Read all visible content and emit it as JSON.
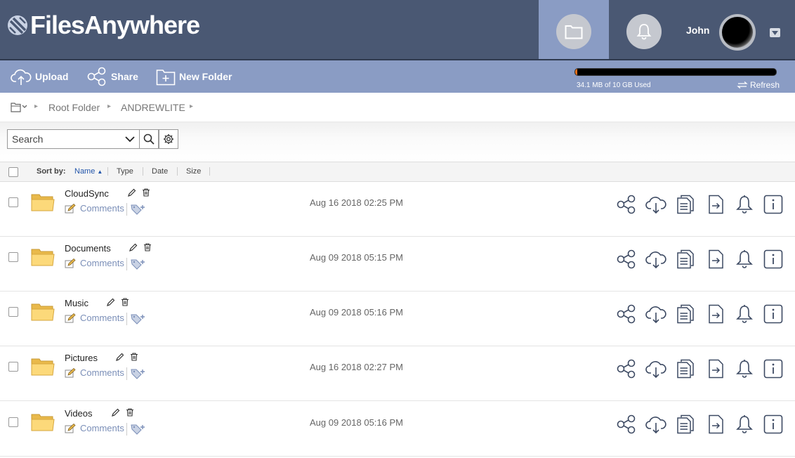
{
  "header": {
    "logo_text": "FilesAnywhere",
    "user_name": "John"
  },
  "toolbar": {
    "upload_label": "Upload",
    "share_label": "Share",
    "new_folder_label": "New Folder",
    "storage_text": "34.1 MB of 10 GB Used",
    "storage_used_fraction": 0.0034,
    "refresh_label": "Refresh"
  },
  "breadcrumb": {
    "items": [
      "Root Folder",
      "ANDREWLITE"
    ]
  },
  "search": {
    "placeholder": "Search"
  },
  "sort": {
    "label": "Sort by:",
    "columns": [
      "Name",
      "Type",
      "Date",
      "Size"
    ],
    "active": "Name"
  },
  "files": [
    {
      "name": "CloudSync",
      "date": "Aug 16 2018 02:25 PM",
      "comments_label": "Comments"
    },
    {
      "name": "Documents",
      "date": "Aug 09 2018 05:15 PM",
      "comments_label": "Comments"
    },
    {
      "name": "Music",
      "date": "Aug 09 2018 05:16 PM",
      "comments_label": "Comments"
    },
    {
      "name": "Pictures",
      "date": "Aug 16 2018 02:27 PM",
      "comments_label": "Comments"
    },
    {
      "name": "Videos",
      "date": "Aug 09 2018 05:16 PM",
      "comments_label": "Comments"
    }
  ],
  "row_actions": [
    "share-icon",
    "cloud-download-icon",
    "copy-icon",
    "move-icon",
    "bell-icon",
    "info-icon"
  ],
  "colors": {
    "header_bg": "#4a5873",
    "toolbar_bg": "#8a9cc4",
    "storage_fill": "#e8711c",
    "link": "#7b8fb8"
  }
}
